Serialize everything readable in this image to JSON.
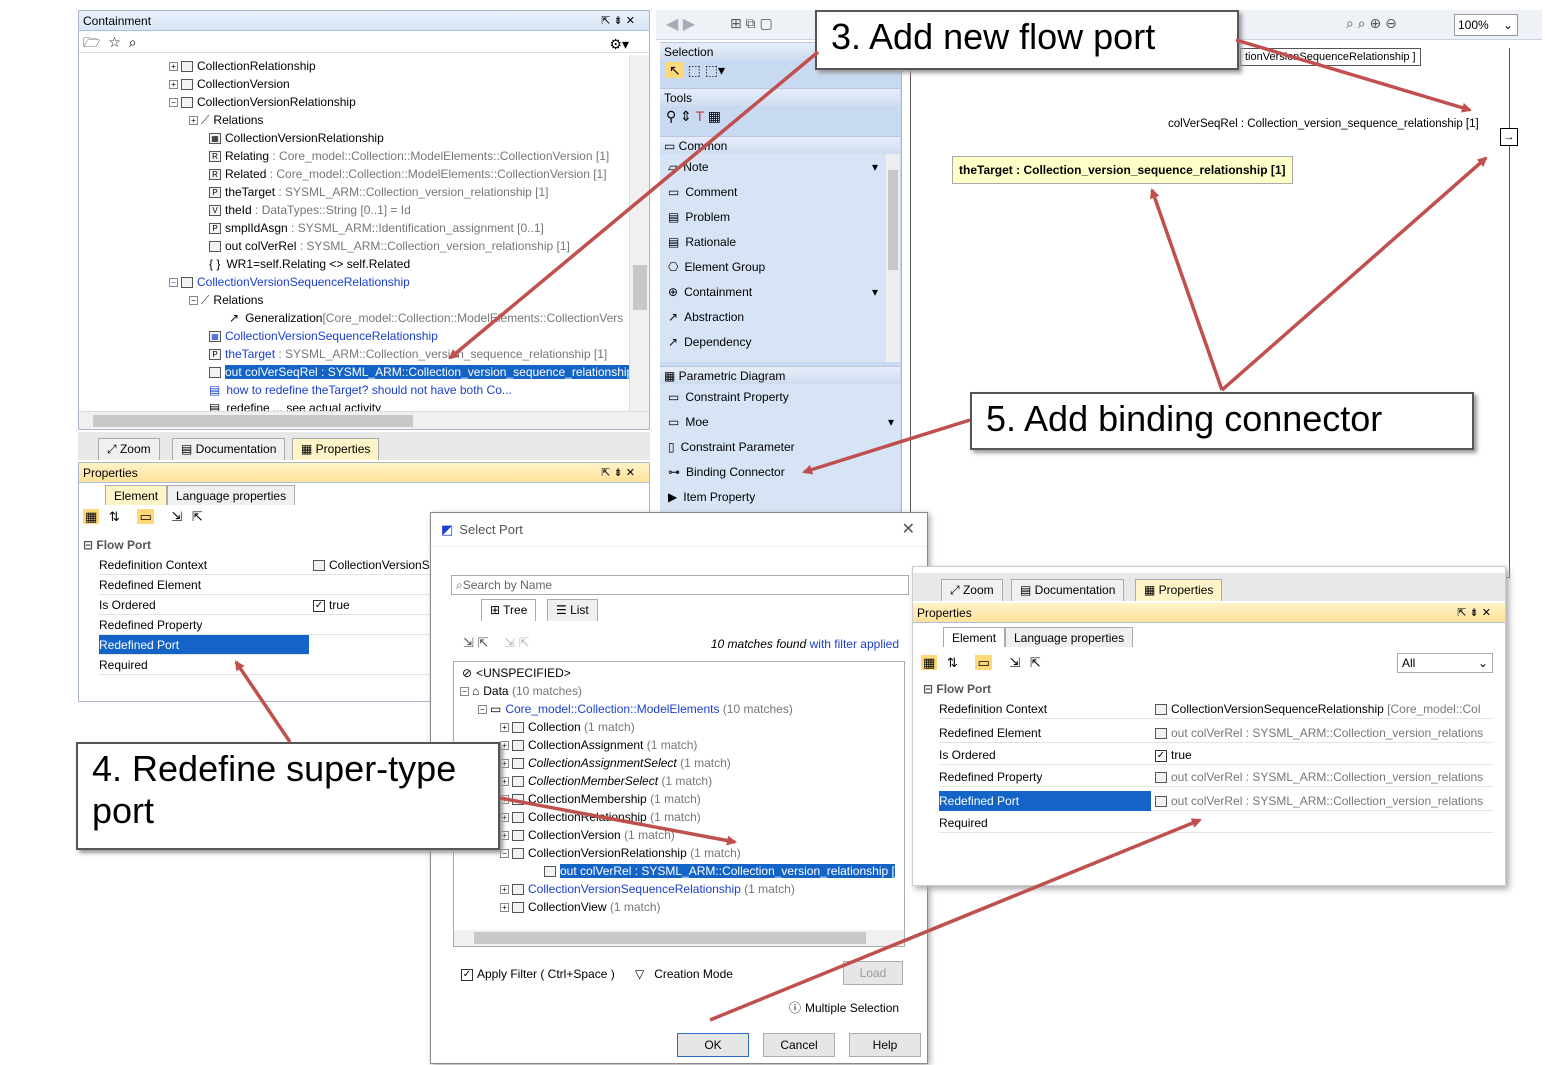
{
  "containment": {
    "title": "Containment",
    "rows": [
      {
        "text": "CollectionRelationship"
      },
      {
        "text": "CollectionVersion"
      },
      {
        "text": "CollectionVersionRelationship"
      },
      {
        "text": "Relations"
      },
      {
        "text": "CollectionVersionRelationship"
      },
      {
        "name": "Relating",
        "rest": " : Core_model::Collection::ModelElements::CollectionVersion [1]"
      },
      {
        "name": "Related",
        "rest": " : Core_model::Collection::ModelElements::CollectionVersion [1]"
      },
      {
        "name": "theTarget",
        "rest": " : SYSML_ARM::Collection_version_relationship [1]"
      },
      {
        "name": "theId",
        "rest": " : DataTypes::String [0..1] = Id"
      },
      {
        "name": "smplIdAsgn",
        "rest": " : SYSML_ARM::Identification_assignment [0..1]"
      },
      {
        "name": "out colVerRel",
        "rest": " : SYSML_ARM::Collection_version_relationship [1]"
      },
      {
        "text": "WR1=self.Relating <> self.Related"
      },
      {
        "text": "CollectionVersionSequenceRelationship"
      },
      {
        "text": "Relations"
      },
      {
        "name": "Generalization",
        "rest": "[Core_model::Collection::ModelElements::CollectionVers"
      },
      {
        "text": "CollectionVersionSequenceRelationship"
      },
      {
        "name": "theTarget",
        "rest": " : SYSML_ARM::Collection_version_sequence_relationship [1]"
      },
      {
        "text": "out colVerSeqRel : SYSML_ARM::Collection_version_sequence_relationship"
      },
      {
        "text": "how to redefine theTarget? should not have both Co..."
      },
      {
        "text": "redefine ... see actual activity"
      }
    ]
  },
  "bottom_tabs": {
    "zoom": "Zoom",
    "documentation": "Documentation",
    "properties": "Properties"
  },
  "properties_left": {
    "title": "Properties",
    "tab_element": "Element",
    "tab_language": "Language properties",
    "group": "Flow Port",
    "rows": [
      {
        "label": "Redefinition Context",
        "value": "CollectionVersionS"
      },
      {
        "label": "Redefined Element",
        "value": ""
      },
      {
        "label": "Is Ordered",
        "value": "true"
      },
      {
        "label": "Redefined Property",
        "value": ""
      },
      {
        "label": "Redefined Port",
        "value": ""
      },
      {
        "label": "Required",
        "value": ""
      }
    ]
  },
  "palette": {
    "selection": "Selection",
    "tools": "Tools",
    "common": "Common",
    "items_common": [
      "Note",
      "Comment",
      "Problem",
      "Rationale",
      "Element Group",
      "Containment",
      "Abstraction",
      "Dependency"
    ],
    "parametric": "Parametric Diagram",
    "items_param": [
      "Constraint Property",
      "Moe",
      "Constraint Parameter",
      "Binding Connector",
      "Item Property"
    ]
  },
  "diagram": {
    "zoom": "100%",
    "frame_title": "tionVersionSequenceRelationship ]",
    "port_label": "colVerSeqRel : Collection_version_sequence_relationship [1]",
    "target_label": "theTarget : Collection_version_sequence_relationship [1]"
  },
  "select_port": {
    "title": "Select Port",
    "search_placeholder": "Search by Name",
    "tab_tree": "Tree",
    "tab_list": "List",
    "matches_a": "10 matches found",
    "matches_b": " with filter applied",
    "rows": [
      {
        "text": "<UNSPECIFIED>",
        "count": ""
      },
      {
        "text": "Data",
        "count": "(10 matches)"
      },
      {
        "text": "Core_model::Collection::ModelElements",
        "count": "(10 matches)"
      },
      {
        "text": "Collection",
        "count": "(1 match)"
      },
      {
        "text": "CollectionAssignment",
        "count": "(1 match)"
      },
      {
        "text": "CollectionAssignmentSelect",
        "count": "(1 match)"
      },
      {
        "text": "CollectionMemberSelect",
        "count": "(1 match)"
      },
      {
        "text": "CollectionMembership",
        "count": "(1 match)"
      },
      {
        "text": "CollectionRelationship",
        "count": "(1 match)"
      },
      {
        "text": "CollectionVersion",
        "count": "(1 match)"
      },
      {
        "text": "CollectionVersionRelationship",
        "count": "(1 match)"
      },
      {
        "text": "out colVerRel : SYSML_ARM::Collection_version_relationship [",
        "count": ""
      },
      {
        "text": "CollectionVersionSequenceRelationship",
        "count": "(1 match)"
      },
      {
        "text": "CollectionView",
        "count": "(1 match)"
      }
    ],
    "apply_filter": "Apply Filter ( Ctrl+Space )",
    "creation_mode": "Creation Mode",
    "load": "Load",
    "multiple_selection": "Multiple Selection",
    "ok": "OK",
    "cancel": "Cancel",
    "help": "Help"
  },
  "properties_right": {
    "title": "Properties",
    "tab_element": "Element",
    "tab_language": "Language properties",
    "filter": "All",
    "group": "Flow Port",
    "rows": [
      {
        "label": "Redefinition Context",
        "value": "CollectionVersionSequenceRelationship",
        "extra": " [Core_model::Col"
      },
      {
        "label": "Redefined Element",
        "value": "out colVerRel",
        "extra": " : SYSML_ARM::Collection_version_relations"
      },
      {
        "label": "Is Ordered",
        "value": "true",
        "extra": ""
      },
      {
        "label": "Redefined Property",
        "value": "out colVerRel",
        "extra": " : SYSML_ARM::Collection_version_relations"
      },
      {
        "label": "Redefined Port",
        "value": "out colVerRel",
        "extra": " : SYSML_ARM::Collection_version_relations"
      },
      {
        "label": "Required",
        "value": "",
        "extra": ""
      }
    ]
  },
  "callouts": {
    "c3": "3. Add new flow port",
    "c4_line1": "4. Redefine super-type",
    "c4_line2": "port",
    "c5": "5. Add binding connector"
  },
  "colors": {
    "arrow": "#c0504d",
    "selection": "#1464c8",
    "highlight": "#ffd87a",
    "link": "#1a3fd0"
  }
}
